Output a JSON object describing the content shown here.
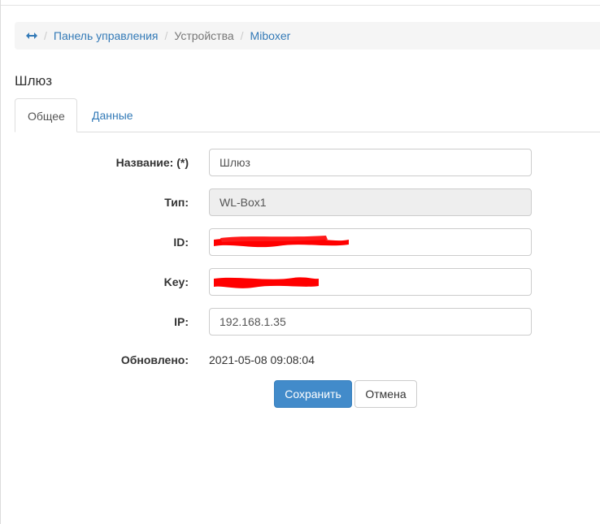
{
  "breadcrumb": {
    "home_icon": "arrows-horizontal-icon",
    "items": [
      {
        "label": "Панель управления"
      },
      {
        "label": "Устройства"
      },
      {
        "label": "Miboxer"
      }
    ]
  },
  "page_title": "Шлюз",
  "tabs": [
    {
      "label": "Общее",
      "active": true
    },
    {
      "label": "Данные",
      "active": false
    }
  ],
  "form": {
    "name_label": "Название: (*)",
    "name_value": "Шлюз",
    "type_label": "Тип:",
    "type_value": "WL-Box1",
    "id_label": "ID:",
    "id_value": "",
    "key_label": "Key:",
    "key_value": "",
    "ip_label": "IP:",
    "ip_value": "192.168.1.35",
    "updated_label": "Обновлено:",
    "updated_value": "2021-05-08 09:08:04"
  },
  "buttons": {
    "save_label": "Сохранить",
    "cancel_label": "Отмена"
  },
  "colors": {
    "link": "#337ab7",
    "primary": "#428bca",
    "redaction": "#ff0000"
  }
}
